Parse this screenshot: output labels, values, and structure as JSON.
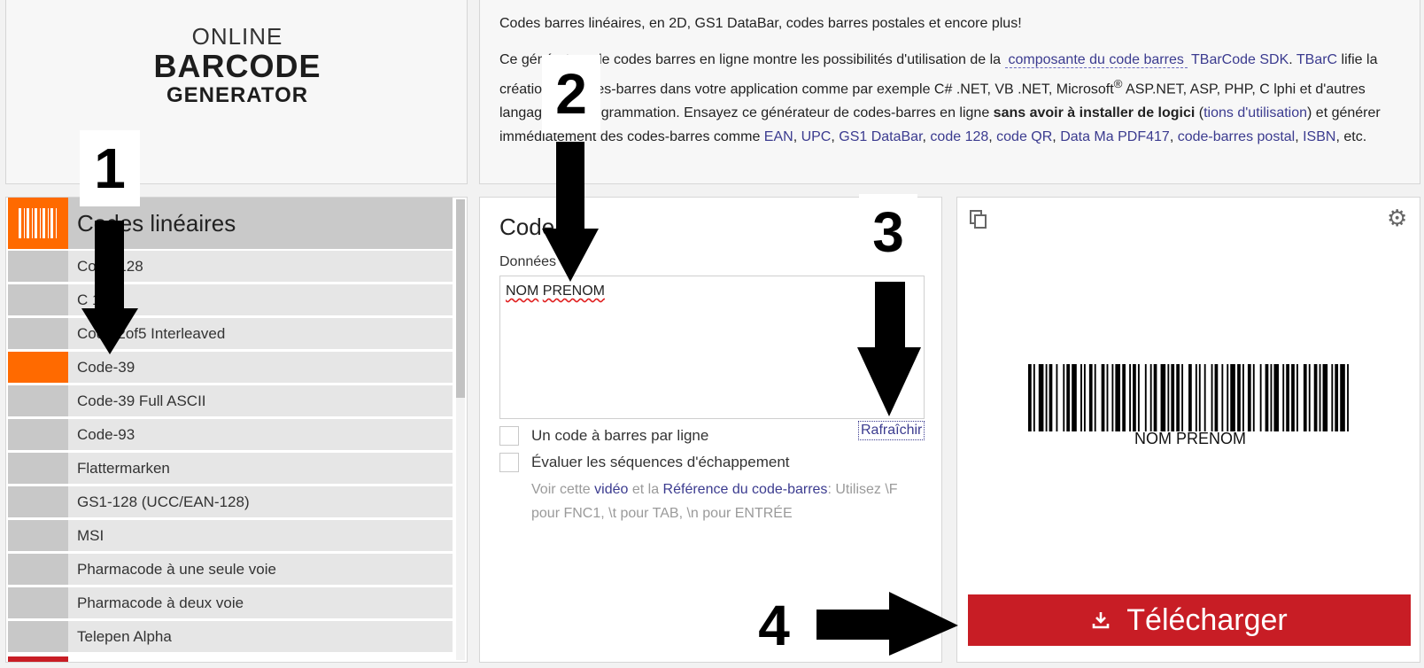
{
  "logo": {
    "line1": "ONLINE",
    "line2": "BARCODE",
    "line3": "GENERATOR"
  },
  "intro": {
    "line1": "Codes barres linéaires, en 2D, GS1 DataBar, codes barres postales et encore plus!",
    "p_part1": "Ce générateur de codes barres en ligne montre les possibilités d'utilisation de la ",
    "link_component": "composante du code barres",
    "link_sdk": "TBarCode SDK",
    "p_part2": ". ",
    "link_tbarc": "TBarC",
    "p_part3": "  lifie la création de codes-barres dans votre application comme par exemple C# .NET, VB .NET, Microsoft",
    "sup": "®",
    "p_part4": " ASP.NET, ASP, PHP, C      lphi et d'autres langages de programmation. Ensayez ce générateur de codes-barres en ligne ",
    "bold_text": "sans avoir à installer de logici",
    "link_conditions": "tions d'utilisation",
    "p_part5": ") et générer immédiatement des codes-barres comme ",
    "link_ean": "EAN",
    "link_upc": "UPC",
    "link_gs1": "GS1 DataBar",
    "link_code128": "code 128",
    "link_qr": "code QR",
    "link_datamatrix": "Data Ma",
    "link_pdf417": "PDF417",
    "link_postal": "code-barres postal",
    "link_isbn": "ISBN",
    "p_end": ", etc."
  },
  "list": {
    "header": "Codes linéaires",
    "items": [
      {
        "label": "Code-128",
        "active": false
      },
      {
        "label": "C       1",
        "active": false
      },
      {
        "label": "Code 2of5 Interleaved",
        "active": false
      },
      {
        "label": "Code-39",
        "active": true
      },
      {
        "label": "Code-39 Full ASCII",
        "active": false
      },
      {
        "label": "Code-93",
        "active": false
      },
      {
        "label": "Flattermarken",
        "active": false
      },
      {
        "label": "GS1-128 (UCC/EAN-128)",
        "active": false
      },
      {
        "label": "MSI",
        "active": false
      },
      {
        "label": "Pharmacode à une seule voie",
        "active": false
      },
      {
        "label": "Pharmacode à deux voie",
        "active": false
      },
      {
        "label": "Telepen Alpha",
        "active": false
      }
    ]
  },
  "form": {
    "title": "Code  9",
    "data_label": "Données",
    "data_value_word1": "NOM",
    "data_value_word2": "PRENOM",
    "refresh": "Rafraîchir",
    "opt_one_per_line": "Un code à barres par ligne",
    "opt_escape": "Évaluer les séquences d'échappement",
    "help_part1": "Voir cette ",
    "help_link_video": "vidéo",
    "help_part2": " et la ",
    "help_link_ref": "Référence du code-barres",
    "help_part3": ": Utilisez \\F pour FNC1, \\t pour TAB, \\n pour ENTRÉE"
  },
  "preview": {
    "barcode_text": "NOM PRENOM",
    "download_label": "Télécharger"
  },
  "annotations": {
    "n1": "1",
    "n2": "2",
    "n3": "3",
    "n4": "4"
  },
  "colors": {
    "accent": "#ff6a00",
    "download": "#c81d25",
    "link": "#3b3b8f"
  }
}
